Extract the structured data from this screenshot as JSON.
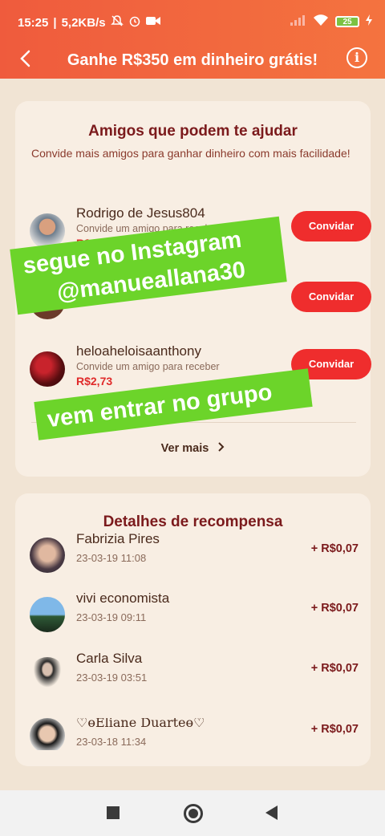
{
  "status_bar": {
    "time": "15:25",
    "speed": "5,2KB/s",
    "battery": "25"
  },
  "header": {
    "title": "Ganhe R$350 em dinheiro grátis!"
  },
  "friends_card": {
    "title": "Amigos que podem te ajudar",
    "subtitle": "Convide mais amigos para ganhar dinheiro com mais facilidade!",
    "friends": [
      {
        "name": "Rodrigo de Jesus804",
        "desc": "Convide um amigo para receber",
        "reward": "R$2,73",
        "button": "Convidar"
      },
      {
        "name": "",
        "desc": "",
        "reward": "",
        "button": "Convidar"
      },
      {
        "name": "heloaheloisaanthony",
        "desc": "Convide um amigo para receber",
        "reward": "R$2,73",
        "button": "Convidar"
      }
    ],
    "see_more": "Ver mais"
  },
  "rewards_card": {
    "title": "Detalhes de recompensa",
    "items": [
      {
        "name": "Fabrizia Pires",
        "date": "23-03-19 11:08",
        "amount": "+ R$0,07"
      },
      {
        "name": "vivi economista",
        "date": "23-03-19 09:11",
        "amount": "+ R$0,07"
      },
      {
        "name": "Carla Silva",
        "date": "23-03-19 03:51",
        "amount": "+ R$0,07"
      },
      {
        "name": "♡ɵEliane Duarteɵ♡",
        "date": "23-03-18 11:34",
        "amount": "+ R$0,07"
      }
    ]
  },
  "overlay": {
    "sticker1_line1": "segue no Instagram",
    "sticker1_line2": "@manueallana30",
    "sticker2": "vem entrar no grupo"
  },
  "colors": {
    "accent": "#ef5b3d",
    "button": "#ef2d2d",
    "sticker": "#6cd42a"
  }
}
